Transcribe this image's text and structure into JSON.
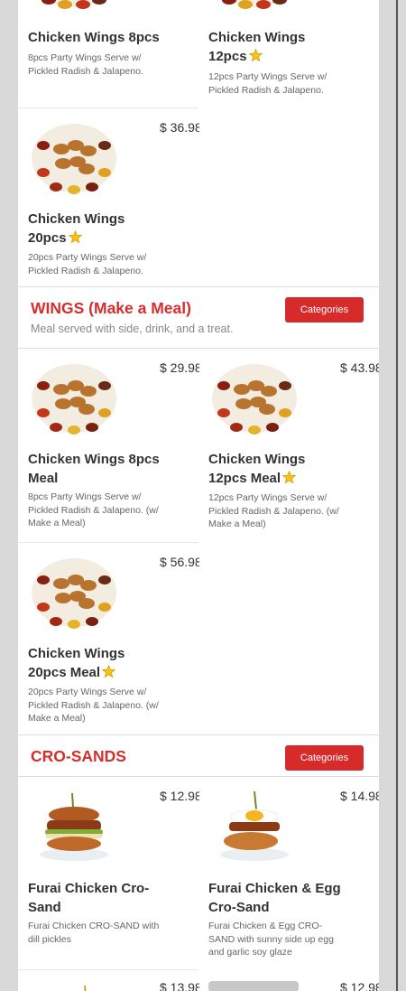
{
  "sections": {
    "wings_meal": {
      "title": "WINGS (Make a Meal)",
      "subtitle": "Meal served with side, drink, and a treat.",
      "button": "Categories"
    },
    "crosands": {
      "title": "CRO-SANDS",
      "button": "Categories"
    }
  },
  "items": {
    "wings8": {
      "name": "Chicken Wings 8pcs",
      "desc": "8pcs Party Wings Serve w/ Pickled Radish & Jalapeno."
    },
    "wings12": {
      "name": "Chicken Wings 12pcs",
      "desc": "12pcs Party Wings Serve w/ Pickled Radish & Jalapeno.",
      "featured": true
    },
    "wings20": {
      "name": "Chicken Wings 20pcs",
      "price": "$ 36.98",
      "desc": "20pcs Party Wings Serve w/ Pickled Radish & Jalapeno.",
      "featured": true
    },
    "wings8meal": {
      "name": "Chicken Wings 8pcs Meal",
      "price": "$ 29.98",
      "desc": "8pcs Party Wings Serve w/ Pickled Radish & Jalapeno. (w/ Make a Meal)"
    },
    "wings12meal": {
      "name": "Chicken Wings 12pcs Meal",
      "price": "$ 43.98",
      "desc": "12pcs Party Wings Serve w/ Pickled Radish & Jalapeno. (w/ Make a Meal)",
      "featured": true
    },
    "wings20meal": {
      "name": "Chicken Wings 20pcs Meal",
      "price": "$ 56.98",
      "desc": "20pcs Party Wings Serve w/ Pickled Radish & Jalapeno. (w/ Make a Meal)",
      "featured": true
    },
    "furai_crosand": {
      "name": "Furai Chicken Cro-Sand",
      "price": "$ 12.98",
      "desc": "Furai Chicken CRO-SAND with dill pickles"
    },
    "furai_egg_crosand": {
      "name": "Furai Chicken & Egg Cro-Sand",
      "price": "$ 14.98",
      "desc": "Furai Chicken & Egg CRO-SAND with sunny side up egg and garlic soy glaze"
    },
    "next_left": {
      "price": "$ 13.98"
    },
    "next_right": {
      "price": "$ 12.98"
    }
  },
  "colors": {
    "accent": "#d72b2b",
    "title_red": "#d62d2d",
    "panel": "#ffffff",
    "backdrop": "#d9d9d9"
  },
  "icons": {
    "featured": "star-icon"
  }
}
